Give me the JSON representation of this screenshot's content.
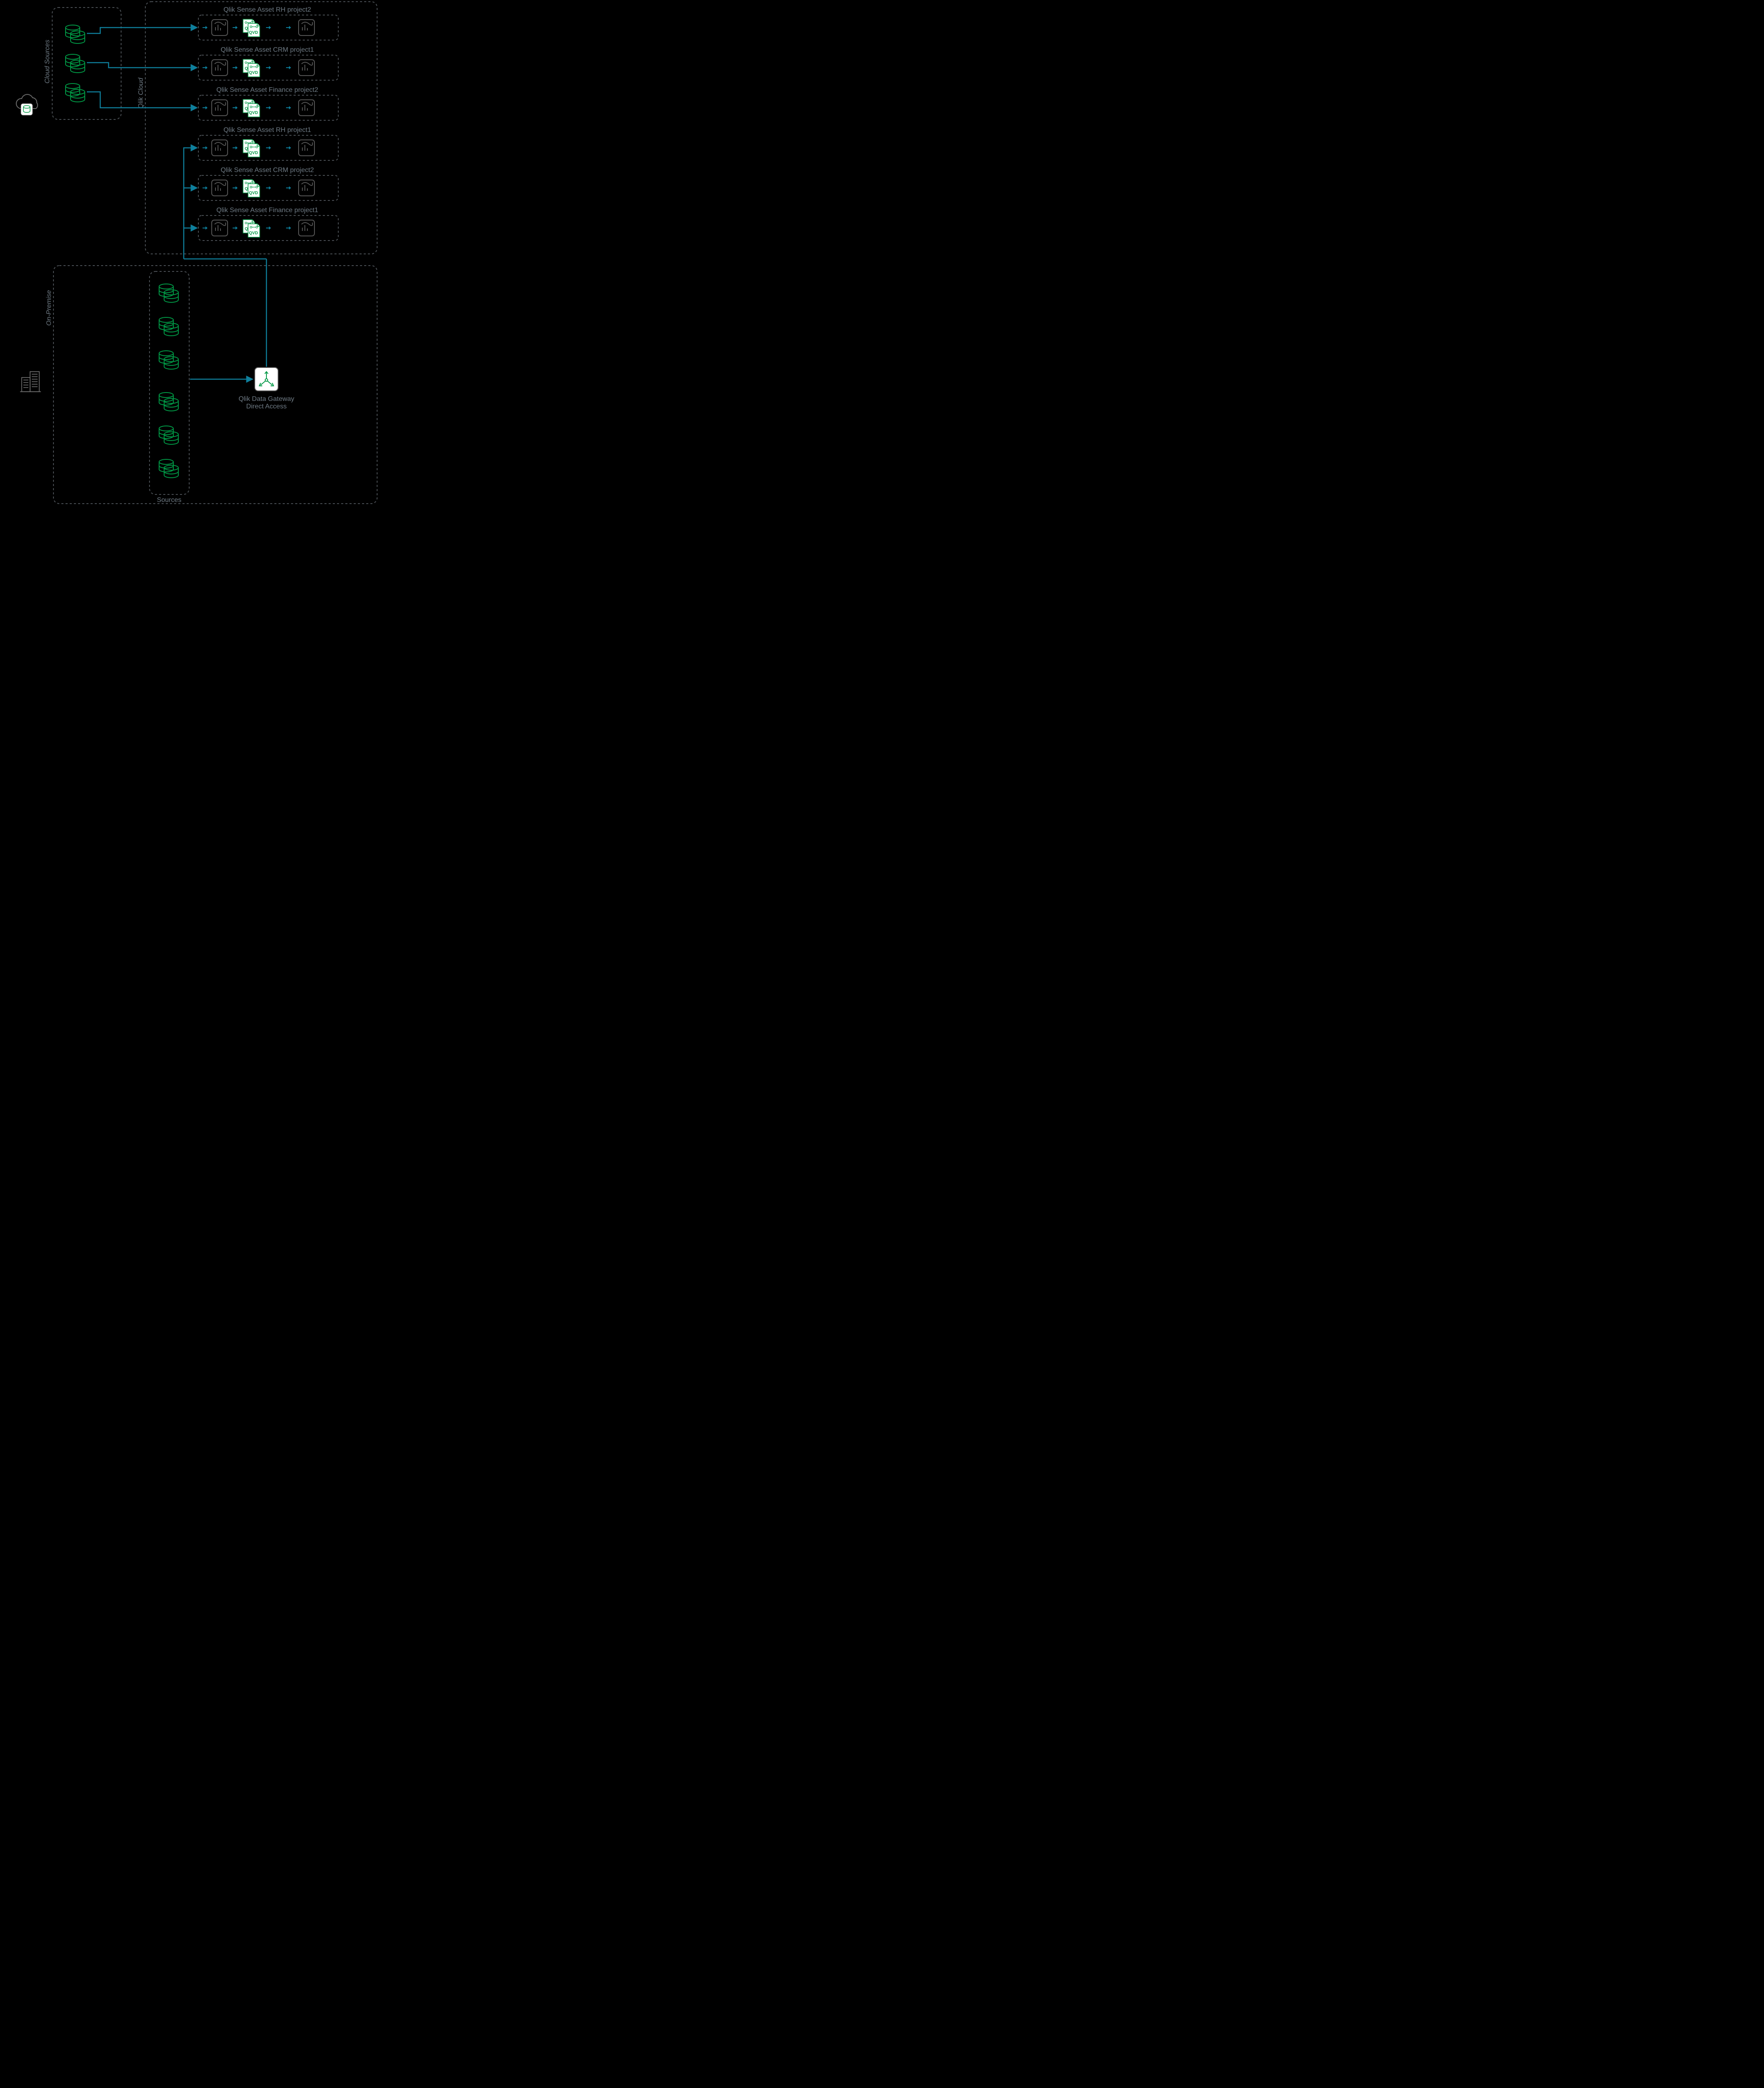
{
  "labels": {
    "cloud_sources": "Cloud Sources",
    "qlik_cloud": "Qlik Cloud",
    "on_premise": "On-Premise",
    "sources": "Sources",
    "qvd": "QVD",
    "qv": "QV"
  },
  "gateway": {
    "line1": "Qlik Data Gateway",
    "line2": "Direct Access"
  },
  "projects": [
    "Qlik Sense Asset RH project2",
    "Qlik Sense Asset CRM project1",
    "Qlik Sense Asset Finance project2",
    "Qlik Sense Asset RH project1",
    "Qlik Sense Asset CRM project2",
    "Qlik Sense Asset Finance project1"
  ]
}
